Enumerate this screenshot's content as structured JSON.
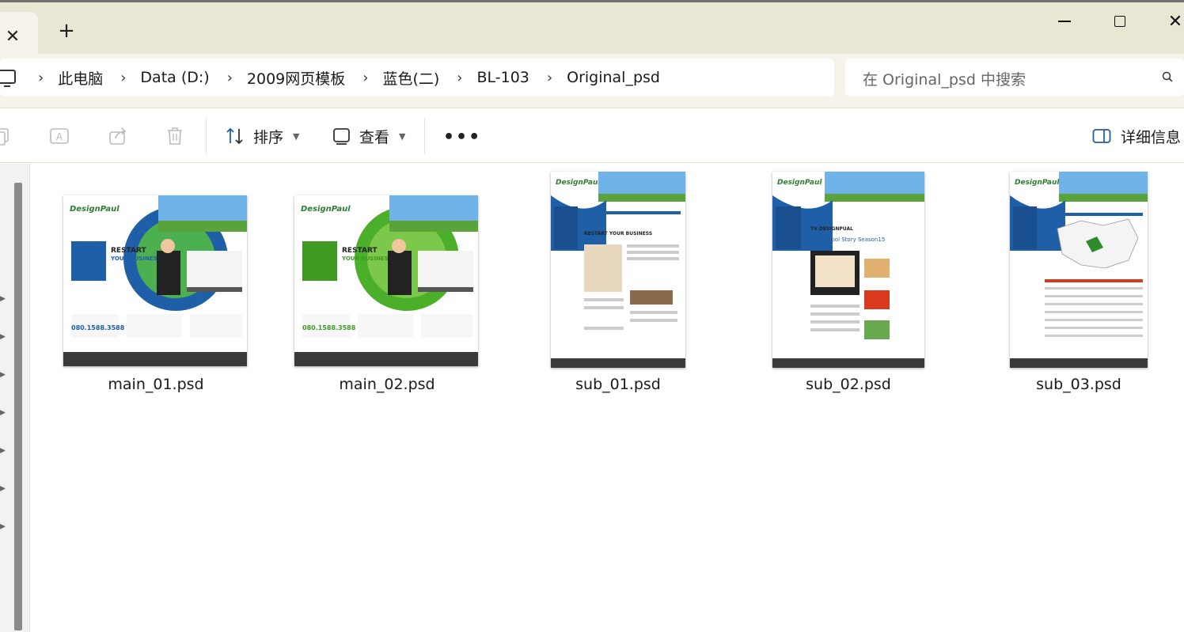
{
  "tabs": {
    "close_icon": "close-icon",
    "new_tab": "+"
  },
  "window": {
    "close": "✕"
  },
  "breadcrumb": {
    "items": [
      "此电脑",
      "Data (D:)",
      "2009网页模板",
      "蓝色(二)",
      "BL-103",
      "Original_psd"
    ],
    "separator": "›"
  },
  "search": {
    "placeholder": "在 Original_psd 中搜索"
  },
  "toolbar": {
    "sort_label": "排序",
    "view_label": "查看",
    "more_label": "•••",
    "details_label": "详细信息"
  },
  "files": [
    {
      "name": "main_01.psd",
      "kind": "main",
      "accent": "#1f5fa8"
    },
    {
      "name": "main_02.psd",
      "kind": "main",
      "accent": "#4caf2a"
    },
    {
      "name": "sub_01.psd",
      "kind": "sub",
      "accent": "#1f5fa8"
    },
    {
      "name": "sub_02.psd",
      "kind": "sub",
      "accent": "#1f5fa8"
    },
    {
      "name": "sub_03.psd",
      "kind": "sub",
      "accent": "#1f5fa8"
    }
  ],
  "colors": {
    "titlebar": "#e9e6d4",
    "address_bg": "#f6f4ea",
    "footer_dark": "#3a3a3a"
  }
}
